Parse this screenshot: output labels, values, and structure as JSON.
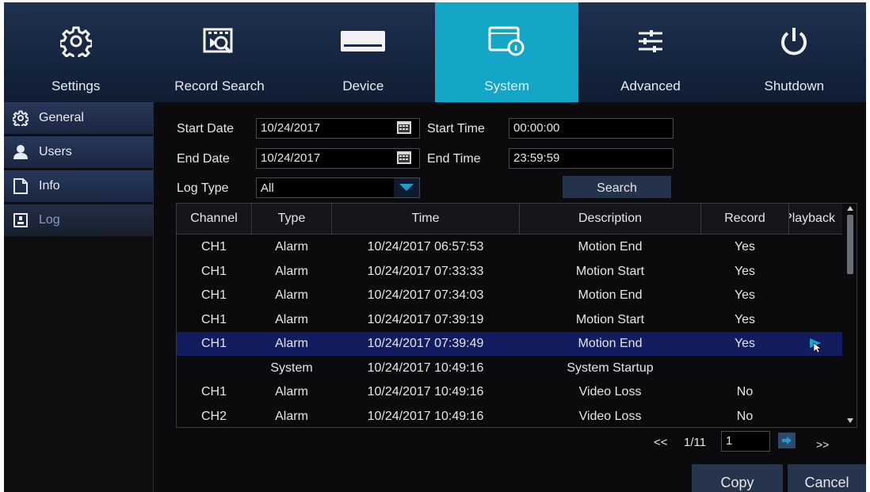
{
  "nav": {
    "items": [
      {
        "label": "Settings",
        "icon": "gear-icon"
      },
      {
        "label": "Record Search",
        "icon": "record-search-icon"
      },
      {
        "label": "Device",
        "icon": "hdd-icon"
      },
      {
        "label": "System",
        "icon": "system-info-icon",
        "active": true
      },
      {
        "label": "Advanced",
        "icon": "sliders-icon"
      },
      {
        "label": "Shutdown",
        "icon": "power-icon"
      }
    ]
  },
  "sidebar": {
    "items": [
      {
        "label": "General",
        "icon": "gear-icon"
      },
      {
        "label": "Users",
        "icon": "user-icon"
      },
      {
        "label": "Info",
        "icon": "document-icon"
      },
      {
        "label": "Log",
        "icon": "log-icon",
        "active": true
      }
    ]
  },
  "filters": {
    "start_date_label": "Start Date",
    "start_date_value": "10/24/2017",
    "start_time_label": "Start Time",
    "start_time_value": "00:00:00",
    "end_date_label": "End Date",
    "end_date_value": "10/24/2017",
    "end_time_label": "End Time",
    "end_time_value": "23:59:59",
    "log_type_label": "Log Type",
    "log_type_value": "All",
    "search_label": "Search"
  },
  "table": {
    "headers": [
      "Channel",
      "Type",
      "Time",
      "Description",
      "Record",
      "Playback"
    ],
    "rows": [
      {
        "channel": "CH1",
        "type": "Alarm",
        "time": "10/24/2017 06:57:53",
        "description": "Motion End",
        "record": "Yes"
      },
      {
        "channel": "CH1",
        "type": "Alarm",
        "time": "10/24/2017 07:33:33",
        "description": "Motion Start",
        "record": "Yes"
      },
      {
        "channel": "CH1",
        "type": "Alarm",
        "time": "10/24/2017 07:34:03",
        "description": "Motion End",
        "record": "Yes"
      },
      {
        "channel": "CH1",
        "type": "Alarm",
        "time": "10/24/2017 07:39:19",
        "description": "Motion Start",
        "record": "Yes"
      },
      {
        "channel": "CH1",
        "type": "Alarm",
        "time": "10/24/2017 07:39:49",
        "description": "Motion End",
        "record": "Yes",
        "selected": true,
        "playback": true
      },
      {
        "channel": "",
        "type": "System",
        "time": "10/24/2017 10:49:16",
        "description": "System Startup",
        "record": ""
      },
      {
        "channel": "CH1",
        "type": "Alarm",
        "time": "10/24/2017 10:49:16",
        "description": "Video Loss",
        "record": "No"
      },
      {
        "channel": "CH2",
        "type": "Alarm",
        "time": "10/24/2017 10:49:16",
        "description": "Video Loss",
        "record": "No"
      }
    ]
  },
  "pager": {
    "prev": "<<",
    "page_info": "1/11",
    "page_input": "1",
    "next": ">>"
  },
  "buttons": {
    "copy": "Copy",
    "cancel": "Cancel"
  },
  "colors": {
    "active_tab": "#13a6c6",
    "selected_row": "#121c5e",
    "accent": "#1a9fd0"
  }
}
